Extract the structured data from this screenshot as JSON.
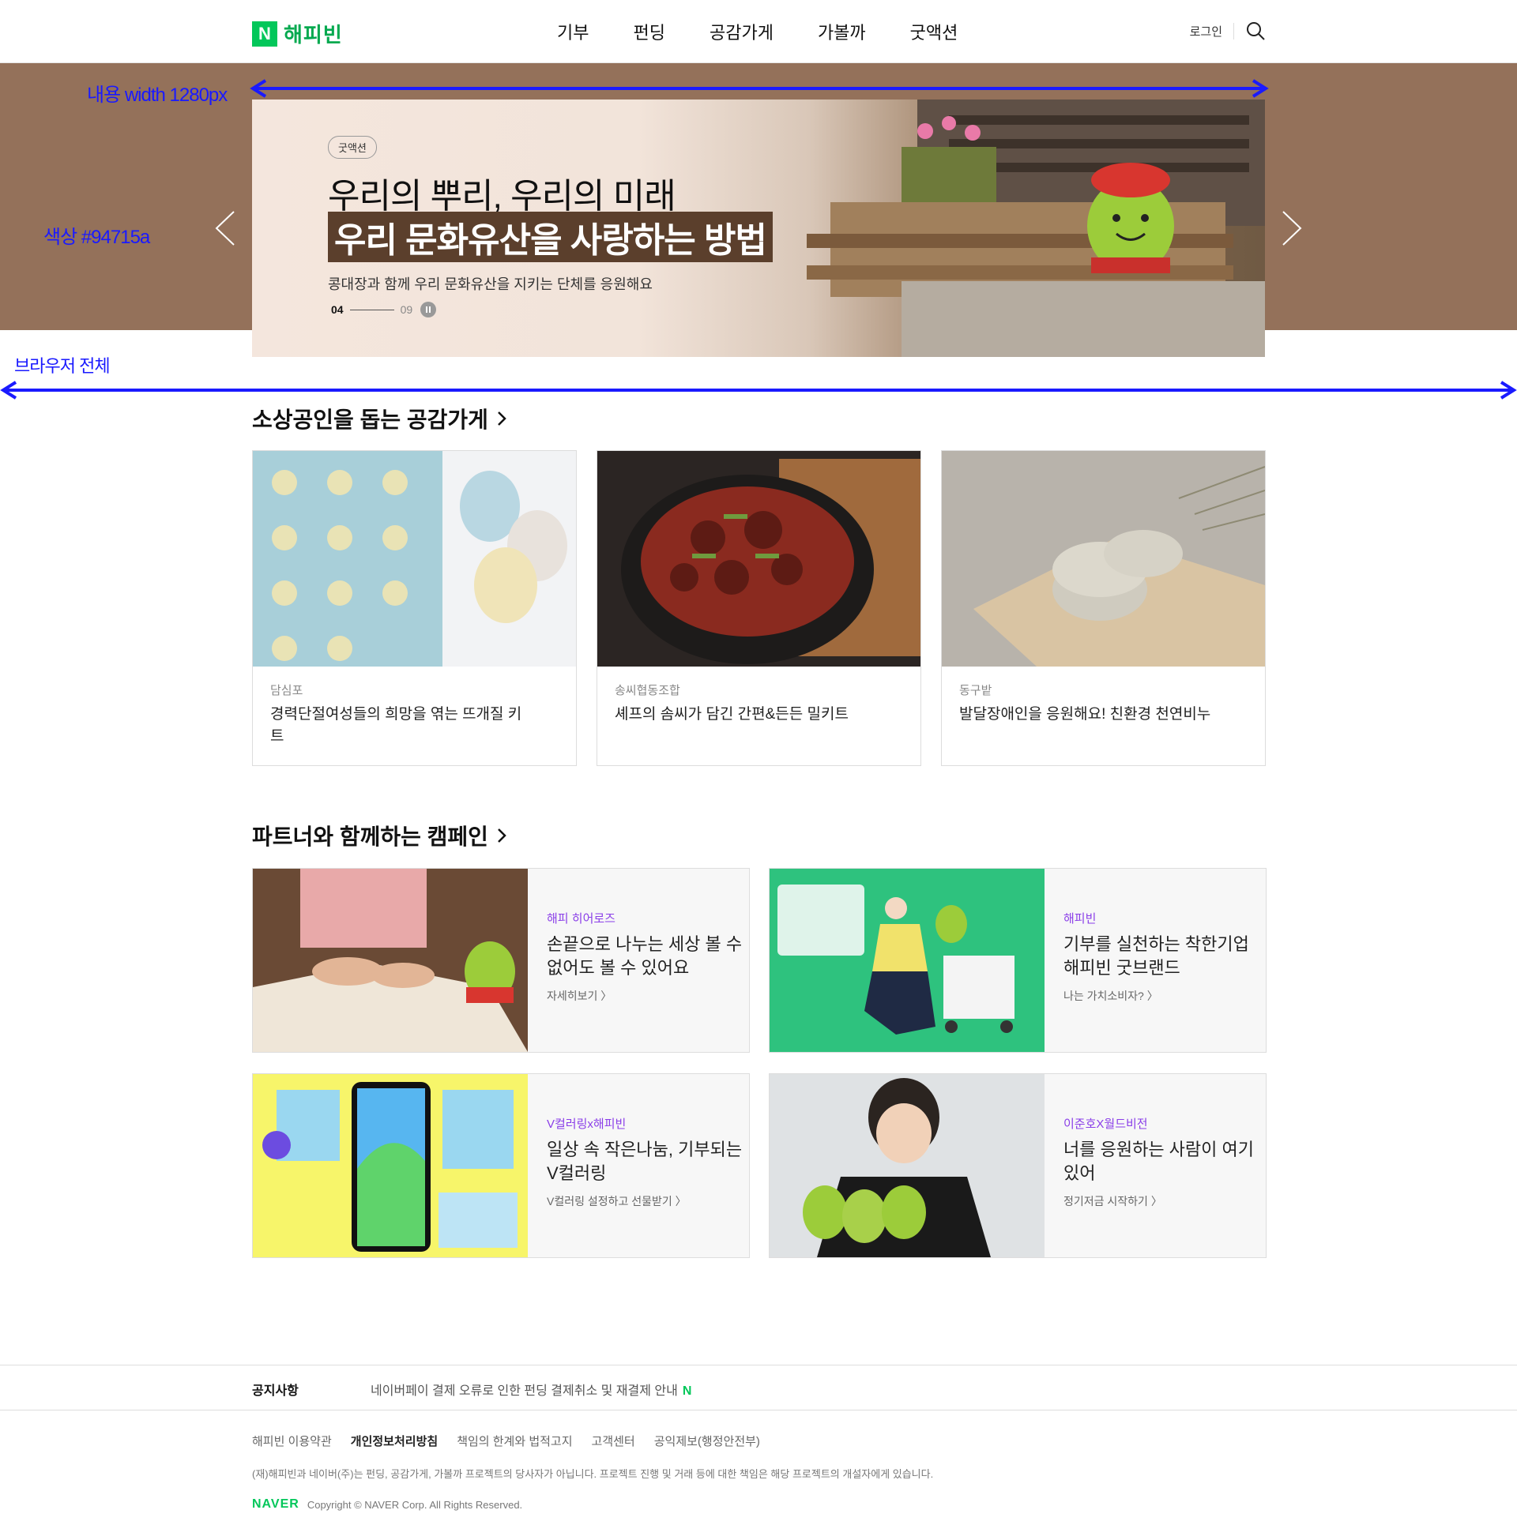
{
  "header": {
    "logo_mark": "N",
    "logo_text": "해피빈",
    "nav": [
      "기부",
      "펀딩",
      "공감가게",
      "가볼까",
      "굿액션"
    ],
    "login": "로그인",
    "search_icon": "search-icon"
  },
  "hero": {
    "badge": "굿액션",
    "title_line1": "우리의 뿌리, 우리의 미래",
    "title_line2": "우리 문화유산을 사랑하는 방법",
    "subtitle": "콩대장과 함께 우리 문화유산을 지키는 단체를 응원해요",
    "pager_current": "04",
    "pager_total": "09",
    "bg_color": "#94715a"
  },
  "annotations": {
    "content_width": "내용 width 1280px",
    "color": "색상 #94715a",
    "browser_full": "브라우저 전체"
  },
  "section1": {
    "title": "소상공인을 돕는 공감가게",
    "cards": [
      {
        "category": "담심포",
        "title": "경력단절여성들의 희망을 엮는 뜨개질 키트"
      },
      {
        "category": "송씨협동조합",
        "title": "셰프의 솜씨가 담긴 간편&든든 밀키트"
      },
      {
        "category": "동구밭",
        "title": "발달장애인을 응원해요! 친환경 천연비누"
      }
    ]
  },
  "section2": {
    "title": "파트너와 함께하는 캠페인",
    "campaigns": [
      {
        "label": "해피 히어로즈",
        "title": "손끝으로 나누는 세상 볼 수 없어도 볼 수 있어요",
        "more": "자세히보기 〉"
      },
      {
        "label": "해피빈",
        "title": "기부를 실천하는 착한기업 해피빈 굿브랜드",
        "more": "나는 가치소비자? 〉"
      },
      {
        "label": "V컬러링x해피빈",
        "title": "일상 속 작은나눔, 기부되는 V컬러링",
        "more": "V컬러링 설정하고 선물받기 〉"
      },
      {
        "label": "이준호X월드비전",
        "title": "너를 응원하는 사람이 여기 있어",
        "more": "정기저금 시작하기 〉"
      }
    ]
  },
  "footer": {
    "notice_label": "공지사항",
    "notice_text": "네이버페이 결제 오류로 인한 펀딩 결제취소 및 재결제 안내",
    "notice_new": "N",
    "links": [
      "해피빈 이용약관",
      "개인정보처리방침",
      "책임의 한계와 법적고지",
      "고객센터",
      "공익제보(행정안전부)"
    ],
    "desc": "(재)해피빈과 네이버(주)는 펀딩, 공감가게, 가볼까 프로젝트의 당사자가 아닙니다. 프로젝트 진행 및 거래 등에 대한 책임은 해당 프로젝트의 개설자에게 있습니다.",
    "brand": "NAVER",
    "copyright": "Copyright © NAVER Corp. All Rights Reserved."
  }
}
